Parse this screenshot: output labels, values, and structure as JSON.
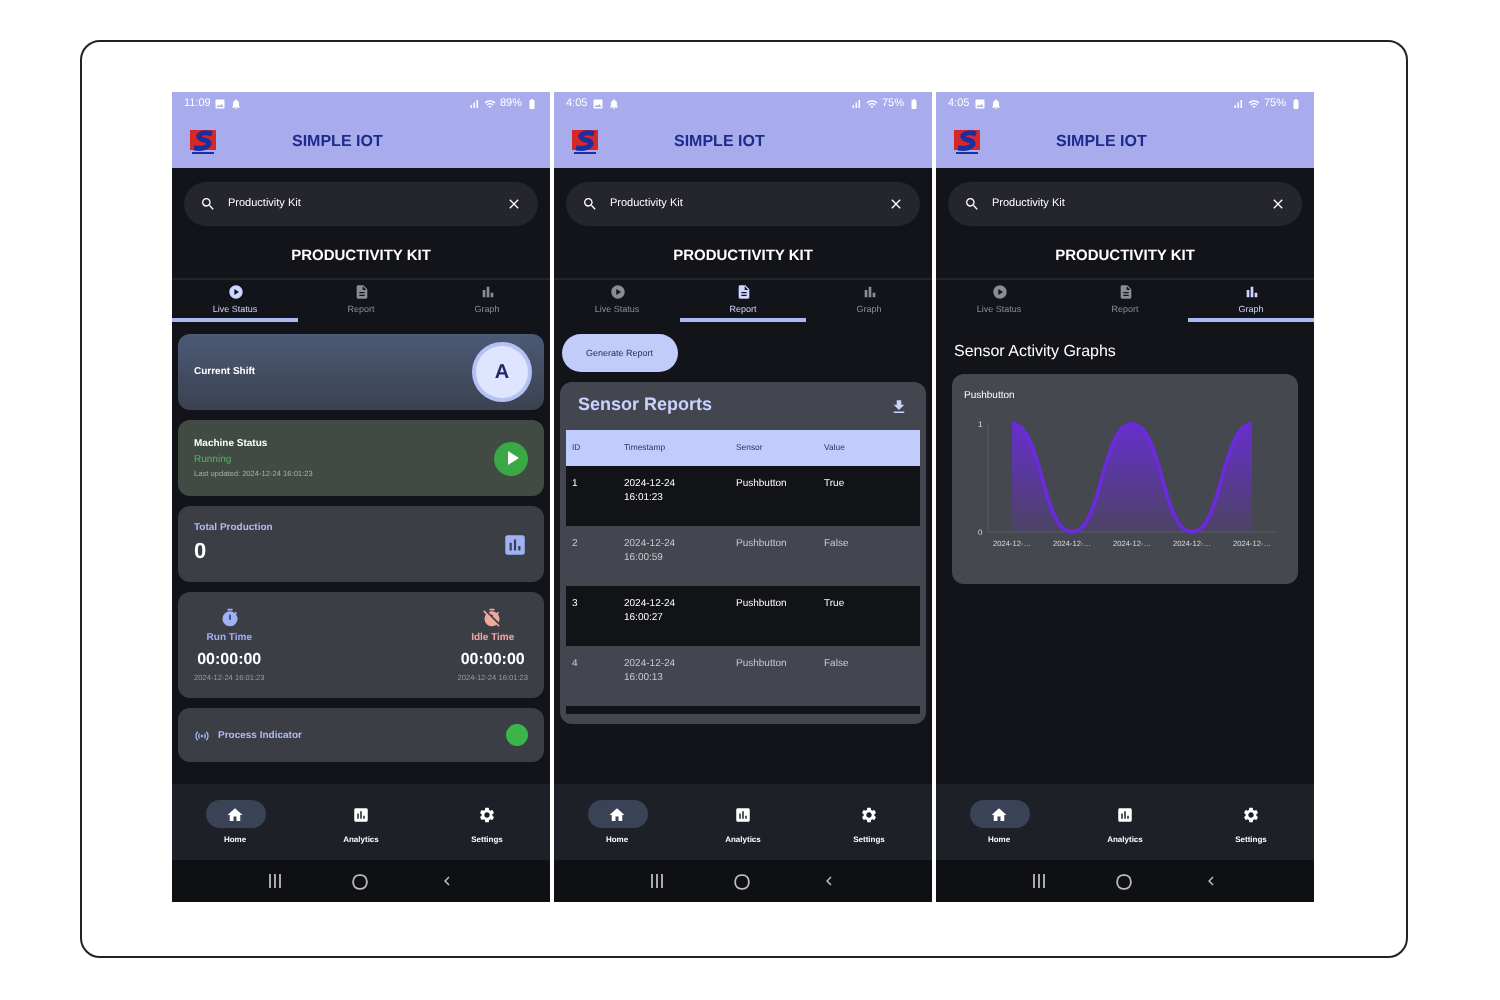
{
  "phones": [
    {
      "status_bar": {
        "time": "11:09",
        "battery": "89%"
      },
      "app_title": "SIMPLE IOT",
      "search": {
        "value": "Productivity Kit"
      },
      "kit_title": "PRODUCTIVITY KIT",
      "tabs": [
        {
          "label": "Live Status",
          "selected": true
        },
        {
          "label": "Report",
          "selected": false
        },
        {
          "label": "Graph",
          "selected": false
        }
      ],
      "content": {
        "kind": "live",
        "shift": {
          "label": "Current Shift",
          "badge": "A"
        },
        "machine": {
          "label": "Machine Status",
          "status": "Running",
          "updated": "Last updated: 2024-12-24 16:01:23"
        },
        "production": {
          "label": "Total Production",
          "value": "0"
        },
        "timers": [
          {
            "kind": "run",
            "label": "Run Time",
            "value": "00:00:00",
            "stamp": "2024-12-24 16:01:23"
          },
          {
            "kind": "idle",
            "label": "Idle Time",
            "value": "00:00:00",
            "stamp": "2024-12-24 16:01:23"
          }
        ],
        "indicator": {
          "label": "Process Indicator",
          "on": true
        }
      },
      "bottom_nav": [
        {
          "label": "Home",
          "selected": true
        },
        {
          "label": "Analytics",
          "selected": false
        },
        {
          "label": "Settings",
          "selected": false
        }
      ]
    },
    {
      "status_bar": {
        "time": "4:05",
        "battery": "75%"
      },
      "app_title": "SIMPLE IOT",
      "search": {
        "value": "Productivity Kit"
      },
      "kit_title": "PRODUCTIVITY KIT",
      "tabs": [
        {
          "label": "Live Status",
          "selected": false
        },
        {
          "label": "Report",
          "selected": true
        },
        {
          "label": "Graph",
          "selected": false
        }
      ],
      "content": {
        "kind": "report",
        "button": "Generate Report",
        "title": "Sensor Reports",
        "columns": [
          "ID",
          "Timestamp",
          "Sensor",
          "Value"
        ],
        "rows": [
          {
            "cells": [
              "1",
              "2024-12-24\n16:01:23",
              "Pushbutton",
              "True"
            ]
          },
          {
            "cells": [
              "2",
              "2024-12-24\n16:00:59",
              "Pushbutton",
              "False"
            ]
          },
          {
            "cells": [
              "3",
              "2024-12-24\n16:00:27",
              "Pushbutton",
              "True"
            ]
          },
          {
            "cells": [
              "4",
              "2024-12-24\n16:00:13",
              "Pushbutton",
              "False"
            ]
          }
        ]
      },
      "bottom_nav": [
        {
          "label": "Home",
          "selected": true
        },
        {
          "label": "Analytics",
          "selected": false
        },
        {
          "label": "Settings",
          "selected": false
        }
      ]
    },
    {
      "status_bar": {
        "time": "4:05",
        "battery": "75%"
      },
      "app_title": "SIMPLE IOT",
      "search": {
        "value": "Productivity Kit"
      },
      "kit_title": "PRODUCTIVITY KIT",
      "tabs": [
        {
          "label": "Live Status",
          "selected": false
        },
        {
          "label": "Report",
          "selected": false
        },
        {
          "label": "Graph",
          "selected": true
        }
      ],
      "content": {
        "kind": "graph",
        "heading": "Sensor Activity Graphs",
        "chart_data": {
          "type": "area",
          "title": "Pushbutton",
          "categories": [
            "2024-12-…",
            "2024-12-…",
            "2024-12-…",
            "2024-12-…",
            "2024-12-…"
          ],
          "yticks": [
            0,
            1
          ],
          "ylim": [
            0,
            1
          ],
          "series": [
            {
              "color": "#6a2bd9",
              "values": [
                1,
                0,
                1,
                0,
                1
              ]
            }
          ]
        }
      },
      "bottom_nav": [
        {
          "label": "Home",
          "selected": true
        },
        {
          "label": "Analytics",
          "selected": false
        },
        {
          "label": "Settings",
          "selected": false
        }
      ]
    }
  ]
}
